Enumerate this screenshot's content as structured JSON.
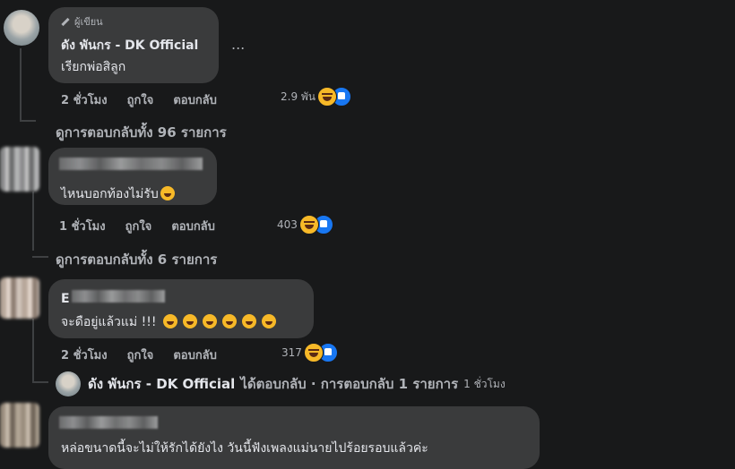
{
  "comments": [
    {
      "author_badge": "ผู้เขียน",
      "author": "ดัง พันกร - DK Official",
      "text": "เรียกพ่อสิลูก",
      "more": "...",
      "time": "2 ชั่วโมง",
      "like_label": "ถูกใจ",
      "reply_label": "ตอบกลับ",
      "reaction_count": "2.9 พัน",
      "view_replies": "ดูการตอบกลับทั้ง 96 รายการ"
    },
    {
      "text": "ไหนบอกท้องไม่รับ",
      "time": "1 ชั่วโมง",
      "like_label": "ถูกใจ",
      "reply_label": "ตอบกลับ",
      "reaction_count": "403",
      "view_replies": "ดูการตอบกลับทั้ง 6 รายการ"
    },
    {
      "author_initial": "E",
      "text": "จะดือยู่แล้วแม่ !!!",
      "time": "2 ชั่วโมง",
      "like_label": "ถูกใจ",
      "reply_label": "ตอบกลับ",
      "reaction_count": "317",
      "reply_preview": {
        "author": "ดัง พันกร - DK Official",
        "action": "ได้ตอบกลับ · การตอบกลับ 1 รายการ",
        "time": "1 ชั่วโมง"
      }
    },
    {
      "text": "หล่อขนาดนี้จะไม่ให้รักได้ยังไง วันนี้ฟังเพลงแม่นายไปร้อยรอบแล้วค่ะ"
    }
  ],
  "colors": {
    "background": "#18191a",
    "bubble": "#3a3b3c",
    "meta": "#b0b3b8",
    "like_blue": "#1877f2",
    "haha_yellow": "#f7b928"
  }
}
